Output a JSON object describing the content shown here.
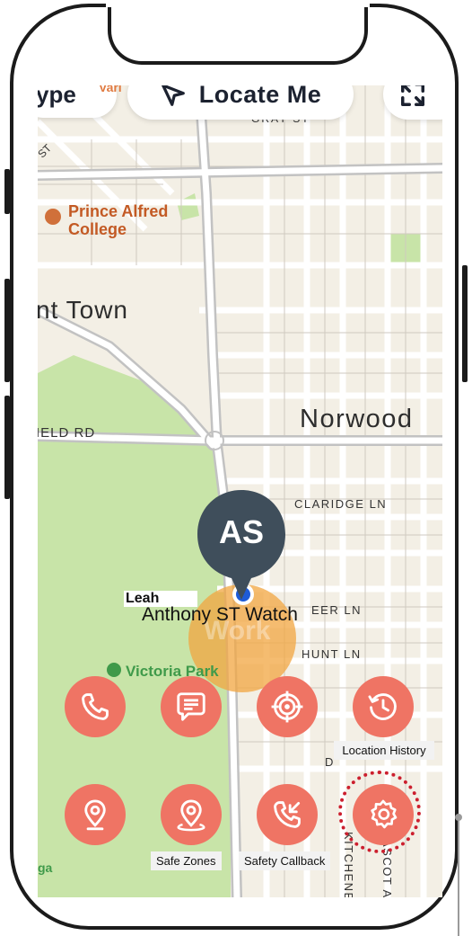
{
  "top_bar": {
    "type_fragment": "ype",
    "vari_fragment": "Vari",
    "locate_label": "Locate Me",
    "expand_icon": "expand-icon",
    "locate_icon": "navigation-arrow-icon"
  },
  "map": {
    "labels": {
      "gray_st": "GRAY ST",
      "st": "ST",
      "prince_alfred": "Prince Alfred",
      "college": "College",
      "town": "nt Town",
      "norwood": "Norwood",
      "field_rd": "IELD RD",
      "claridge_ln": "CLARIDGE LN",
      "beer_ln": "EER LN",
      "hunt_ln": "HUNT LN",
      "victoria_park": "Victoria Park",
      "kitchener": "KITCHENE",
      "ascot": "ASCOT A",
      "d": "D",
      "ga": "ga",
      "work": "Work"
    },
    "device": {
      "initials": "AS",
      "owner_name": "Leah",
      "device_name": "Anthony ST Watch"
    },
    "colors": {
      "land": "#f3efe5",
      "park": "#c8e4a8",
      "road": "#ffffff",
      "main_road": "#bdbdbd",
      "pin": "#3f4e5b",
      "dot": "#1e5bd6",
      "geofence": "#f2a640"
    }
  },
  "actions": {
    "row1": [
      {
        "icon": "phone-icon",
        "label": ""
      },
      {
        "icon": "message-icon",
        "label": ""
      },
      {
        "icon": "target-icon",
        "label": ""
      },
      {
        "icon": "history-icon",
        "label": "Location History"
      }
    ],
    "row2": [
      {
        "icon": "location-pin-icon",
        "label": ""
      },
      {
        "icon": "safe-zones-icon",
        "label": "Safe Zones"
      },
      {
        "icon": "safety-callback-icon",
        "label": "Safety Callback"
      },
      {
        "icon": "settings-icon",
        "label": ""
      }
    ],
    "button_color": "#ef7464",
    "highlight_color": "#cc1f2e"
  }
}
